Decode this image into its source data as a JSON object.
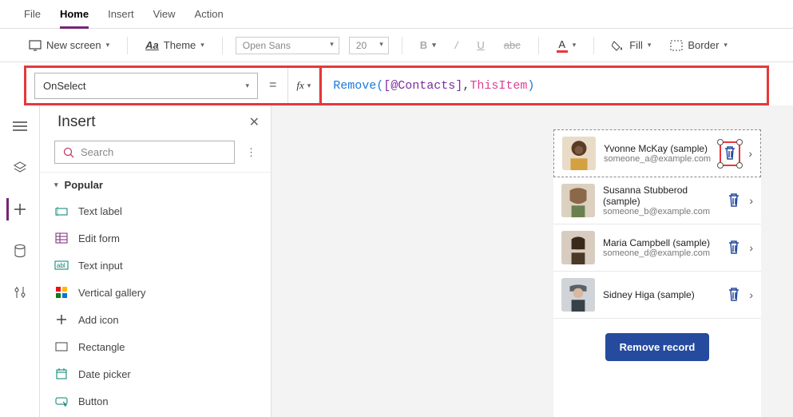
{
  "menu": {
    "file": "File",
    "home": "Home",
    "insert": "Insert",
    "view": "View",
    "action": "Action"
  },
  "toolbar": {
    "new_screen": "New screen",
    "theme": "Theme",
    "font": "Open Sans",
    "size": "20",
    "fill": "Fill",
    "border": "Border"
  },
  "formula": {
    "property": "OnSelect",
    "fn": "Remove",
    "lparen": "( ",
    "ds": "[@Contacts]",
    "comma": ", ",
    "item": "ThisItem",
    "rparen": " )"
  },
  "insert": {
    "title": "Insert",
    "search_ph": "Search",
    "category": "Popular",
    "items": [
      "Text label",
      "Edit form",
      "Text input",
      "Vertical gallery",
      "Add icon",
      "Rectangle",
      "Date picker",
      "Button"
    ]
  },
  "contacts": [
    {
      "name": "Yvonne McKay (sample)",
      "email": "someone_a@example.com"
    },
    {
      "name": "Susanna Stubberod (sample)",
      "email": "someone_b@example.com"
    },
    {
      "name": "Maria Campbell (sample)",
      "email": "someone_d@example.com"
    },
    {
      "name": "Sidney Higa (sample)",
      "email": ""
    }
  ],
  "remove_button": "Remove record"
}
